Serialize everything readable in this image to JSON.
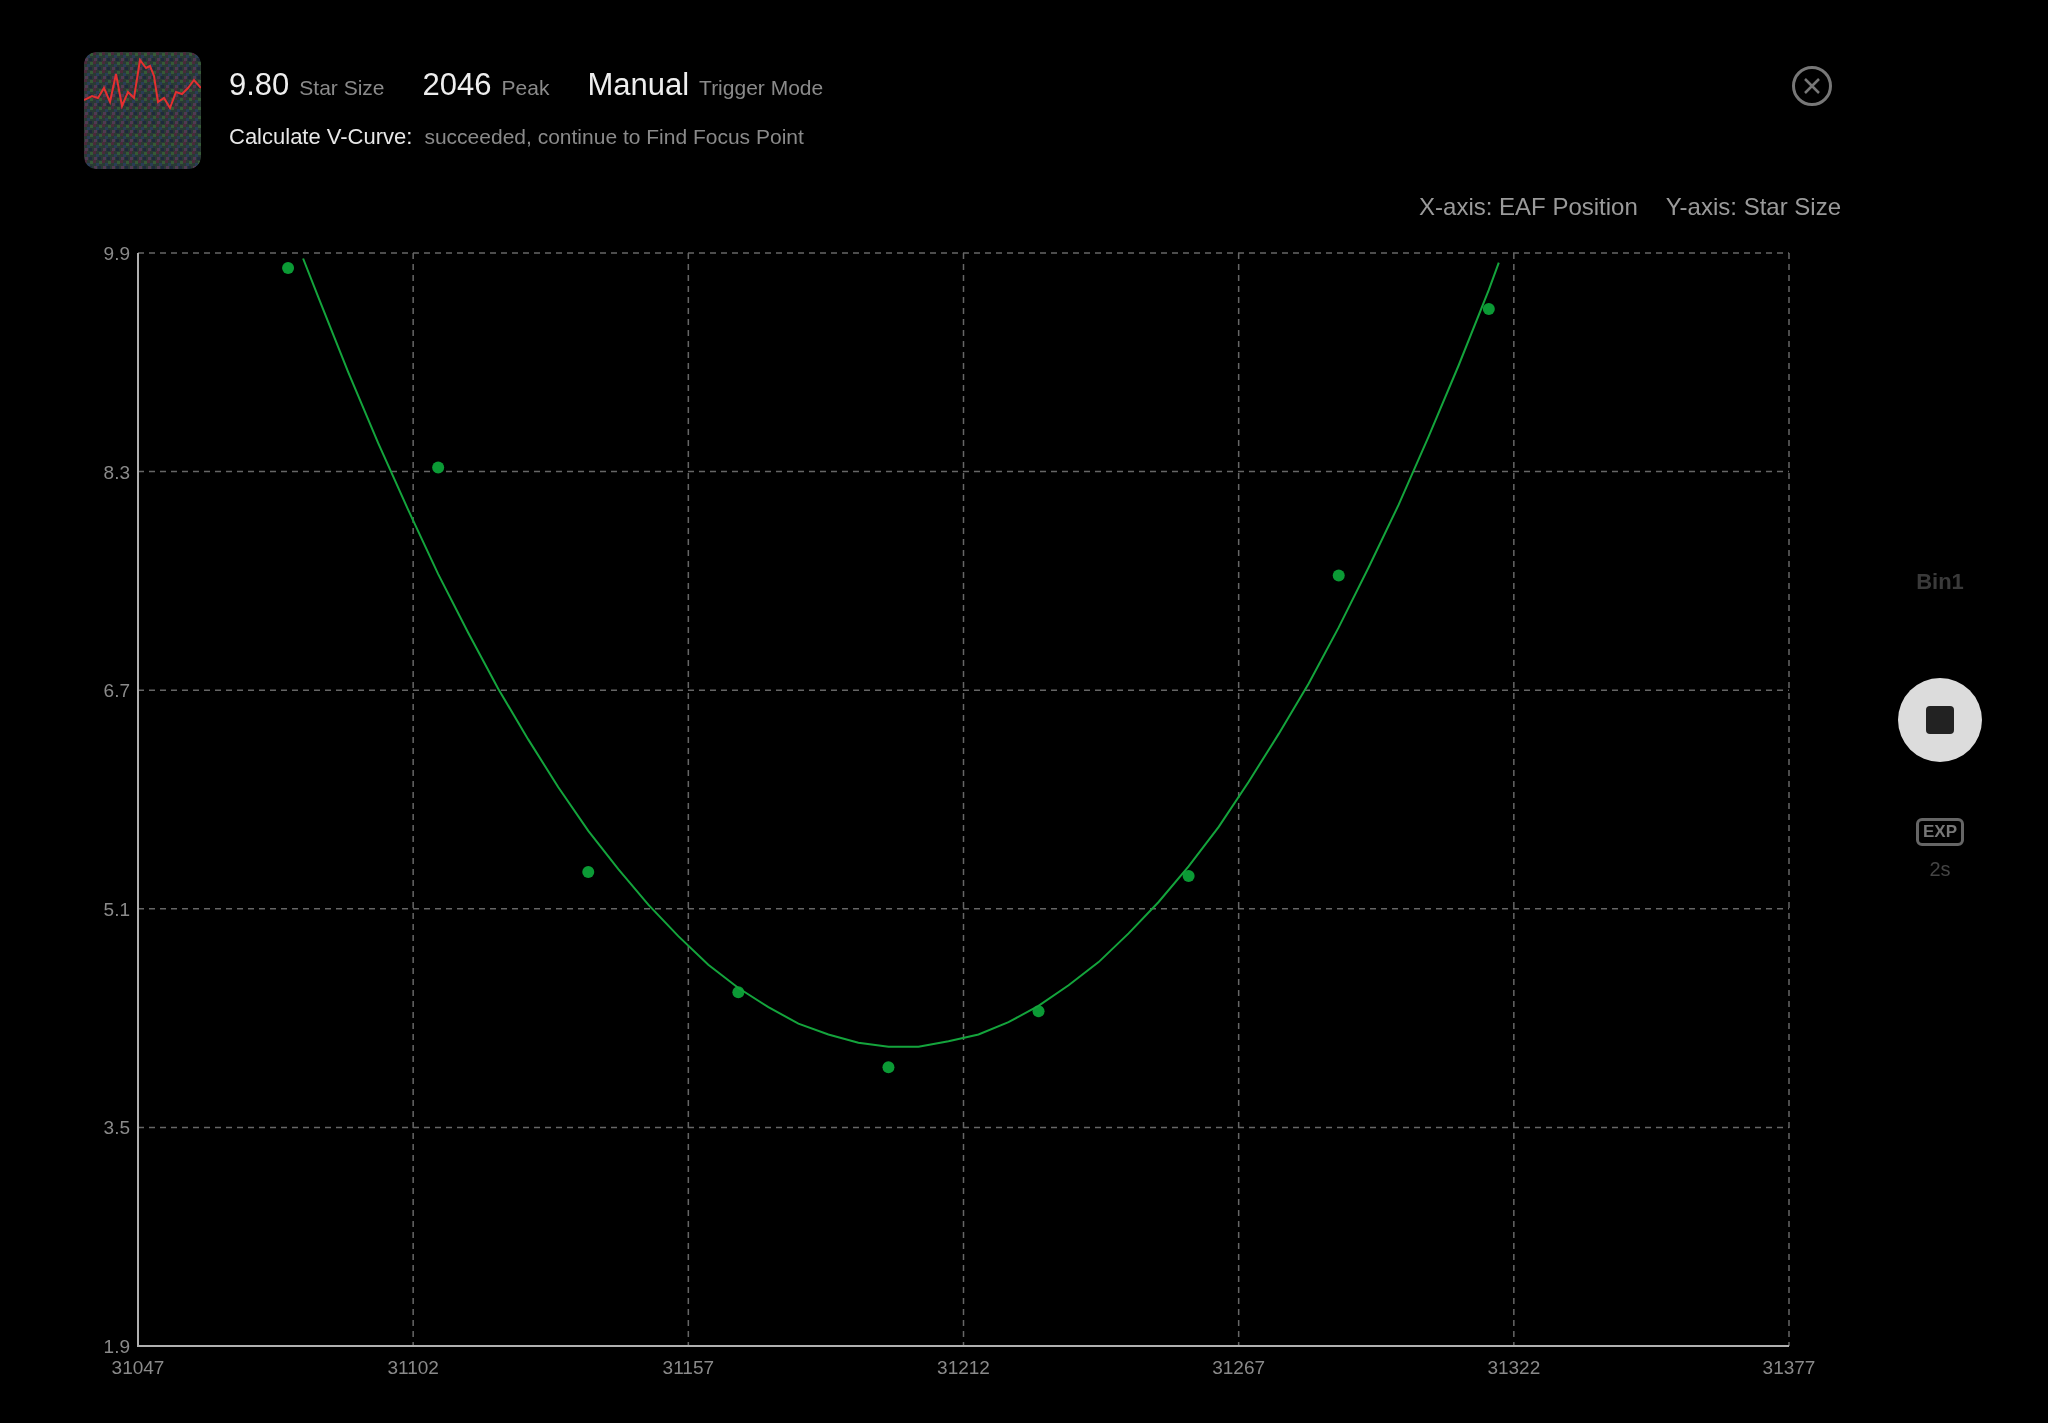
{
  "header": {
    "stats": [
      {
        "value": "9.80",
        "caption": "Star Size"
      },
      {
        "value": "2046",
        "caption": "Peak"
      },
      {
        "value": "Manual",
        "caption": "Trigger Mode"
      }
    ],
    "status": {
      "label": "Calculate V-Curve:",
      "message": "succeeded, continue to Find Focus Point"
    }
  },
  "axis_legend": [
    "X-axis: EAF Position",
    "Y-axis: Star Size"
  ],
  "chart": {
    "chart_data": {
      "type": "scatter",
      "x": [
        31077,
        31107,
        31137,
        31167,
        31197,
        31227,
        31257,
        31287,
        31317
      ],
      "series": [
        {
          "color": "#0b9a35",
          "values": [
            9.79,
            8.33,
            5.37,
            4.49,
            3.94,
            4.35,
            5.34,
            7.54,
            9.49
          ]
        }
      ],
      "xlim": [
        31047,
        31377
      ],
      "ylim": [
        1.9,
        9.9
      ],
      "xticks": [
        31047,
        31102,
        31157,
        31212,
        31267,
        31322,
        31377
      ],
      "yticks": [
        1.9,
        3.5,
        5.1,
        6.7,
        8.3,
        9.9
      ],
      "grid": true
    }
  },
  "fit_curve": {
    "chart_data": {
      "type": "line",
      "x": [
        31080,
        31083,
        31089,
        31095,
        31101,
        31107,
        31113,
        31119,
        31125,
        31131,
        31137,
        31143,
        31149,
        31155,
        31161,
        31167,
        31173,
        31179,
        31185,
        31191,
        31197,
        31203,
        31209,
        31215,
        31221,
        31227,
        31233,
        31239,
        31245,
        31251,
        31257,
        31263,
        31269,
        31275,
        31281,
        31287,
        31293,
        31299,
        31305,
        31311,
        31317,
        31319
      ],
      "series": [
        {
          "color": "#14a43c",
          "values": [
            9.86,
            9.58,
            9.03,
            8.51,
            8.02,
            7.55,
            7.12,
            6.71,
            6.34,
            5.99,
            5.67,
            5.39,
            5.13,
            4.9,
            4.69,
            4.52,
            4.38,
            4.26,
            4.18,
            4.12,
            4.09,
            4.09,
            4.13,
            4.18,
            4.27,
            4.39,
            4.54,
            4.71,
            4.92,
            5.15,
            5.41,
            5.7,
            6.03,
            6.38,
            6.75,
            7.16,
            7.6,
            8.06,
            8.56,
            9.08,
            9.63,
            9.83
          ]
        }
      ],
      "xlim": [
        31047,
        31377
      ],
      "ylim": [
        1.9,
        9.9
      ]
    }
  },
  "controls": {
    "binning": "Bin1",
    "exposure_badge": "EXP",
    "exposure": "2s"
  }
}
